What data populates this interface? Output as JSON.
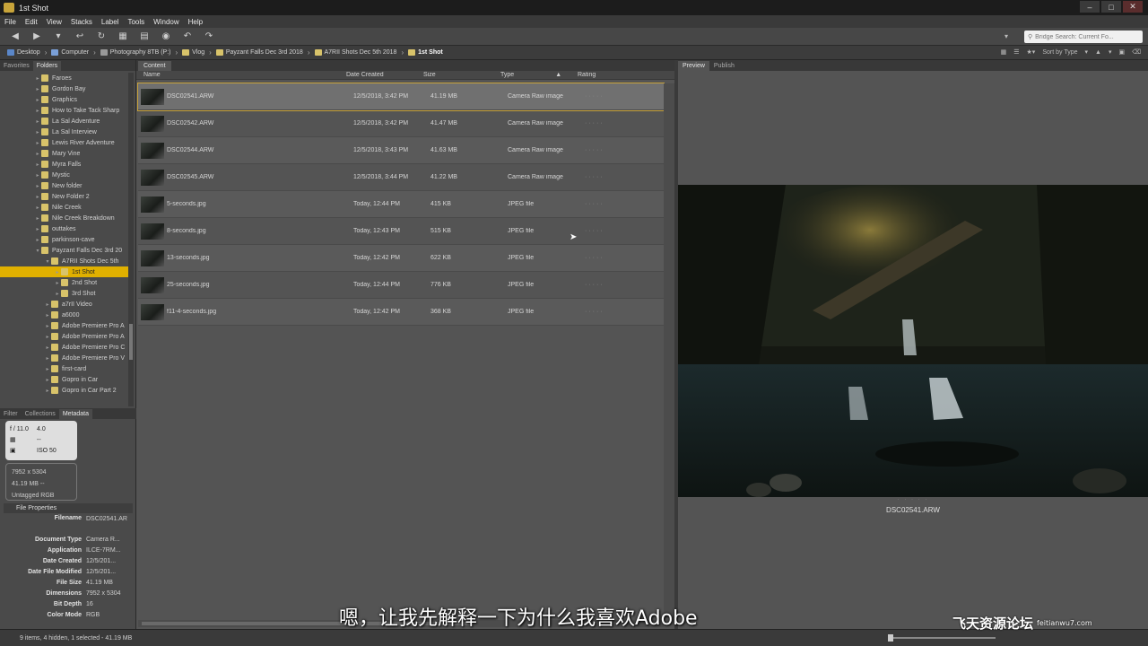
{
  "window": {
    "title": "1st Shot"
  },
  "menu": [
    "File",
    "Edit",
    "View",
    "Stacks",
    "Label",
    "Tools",
    "Window",
    "Help"
  ],
  "search": {
    "placeholder": "Bridge Search: Current Fo..."
  },
  "breadcrumb": [
    {
      "label": "Desktop"
    },
    {
      "label": "Computer"
    },
    {
      "label": "Photography 8TB (P:)"
    },
    {
      "label": "Vlog"
    },
    {
      "label": "Payzant Falls Dec 3rd 2018"
    },
    {
      "label": "A7RII Shots Dec 5th 2018"
    },
    {
      "label": "1st Shot"
    }
  ],
  "sort_label": "Sort by Type",
  "left_tabs": [
    "Favorites",
    "Folders"
  ],
  "folders": [
    {
      "label": "Faroes",
      "depth": 0
    },
    {
      "label": "Gordon Bay",
      "depth": 0
    },
    {
      "label": "Graphics",
      "depth": 0
    },
    {
      "label": "How to Take Tack Sharp",
      "depth": 0
    },
    {
      "label": "La Sal Adventure",
      "depth": 0
    },
    {
      "label": "La Sal Interview",
      "depth": 0
    },
    {
      "label": "Lewis River Adventure",
      "depth": 0
    },
    {
      "label": "Mary Vine",
      "depth": 0
    },
    {
      "label": "Myra Falls",
      "depth": 0
    },
    {
      "label": "Mystic",
      "depth": 0
    },
    {
      "label": "New folder",
      "depth": 0
    },
    {
      "label": "New Folder 2",
      "depth": 0
    },
    {
      "label": "Nile Creek",
      "depth": 0
    },
    {
      "label": "Nile Creek Breakdown",
      "depth": 0
    },
    {
      "label": "outtakes",
      "depth": 0
    },
    {
      "label": "parkinson-cave",
      "depth": 0
    },
    {
      "label": "Payzant Falls Dec 3rd 20",
      "depth": 0
    },
    {
      "label": "A7RII Shots Dec 5th",
      "depth": 1
    },
    {
      "label": "1st Shot",
      "depth": 2,
      "selected": true
    },
    {
      "label": "2nd Shot",
      "depth": 2
    },
    {
      "label": "3rd Shot",
      "depth": 2
    },
    {
      "label": "a7rII Video",
      "depth": 1
    },
    {
      "label": "a6000",
      "depth": 1
    },
    {
      "label": "Adobe Premiere Pro A",
      "depth": 1
    },
    {
      "label": "Adobe Premiere Pro A",
      "depth": 1
    },
    {
      "label": "Adobe Premiere Pro C",
      "depth": 1
    },
    {
      "label": "Adobe Premiere Pro V",
      "depth": 1
    },
    {
      "label": "first-card",
      "depth": 1
    },
    {
      "label": "Gopro in Car",
      "depth": 1
    },
    {
      "label": "Gopro in Car Part 2",
      "depth": 1
    }
  ],
  "meta_tabs": [
    "Filter",
    "Collections",
    "Metadata"
  ],
  "exif": {
    "aperture": "f / 11.0",
    "shutter": "4.0",
    "dash": "--",
    "iso": "ISO 50"
  },
  "image_info": {
    "dimensions": "7952 x 5304",
    "size": "41.19 MB",
    "size_extra": "--",
    "color": "Untagged RGB"
  },
  "file_properties": {
    "header": "File Properties",
    "rows": [
      {
        "k": "Filename",
        "v": "DSC02541.ARW"
      },
      {
        "k": "Document Type",
        "v": "Camera R..."
      },
      {
        "k": "Application",
        "v": "ILCE-7RM..."
      },
      {
        "k": "Date Created",
        "v": "12/5/201..."
      },
      {
        "k": "Date File Modified",
        "v": "12/5/201..."
      },
      {
        "k": "File Size",
        "v": "41.19 MB"
      },
      {
        "k": "Dimensions",
        "v": "7952 x 5304"
      },
      {
        "k": "Bit Depth",
        "v": "16"
      },
      {
        "k": "Color Mode",
        "v": "RGB"
      }
    ]
  },
  "content": {
    "tab": "Content",
    "columns": [
      "Name",
      "Date Created",
      "Size",
      "Type",
      "Rating"
    ],
    "files": [
      {
        "name": "DSC02541.ARW",
        "date": "12/5/2018, 3:42 PM",
        "size": "41.19 MB",
        "type": "Camera Raw image",
        "selected": true
      },
      {
        "name": "DSC02542.ARW",
        "date": "12/5/2018, 3:42 PM",
        "size": "41.47 MB",
        "type": "Camera Raw image"
      },
      {
        "name": "DSC02544.ARW",
        "date": "12/5/2018, 3:43 PM",
        "size": "41.63 MB",
        "type": "Camera Raw image"
      },
      {
        "name": "DSC02545.ARW",
        "date": "12/5/2018, 3:44 PM",
        "size": "41.22 MB",
        "type": "Camera Raw image"
      },
      {
        "name": "5-seconds.jpg",
        "date": "Today, 12:44 PM",
        "size": "415 KB",
        "type": "JPEG file"
      },
      {
        "name": "8-seconds.jpg",
        "date": "Today, 12:43 PM",
        "size": "515 KB",
        "type": "JPEG file"
      },
      {
        "name": "13-seconds.jpg",
        "date": "Today, 12:42 PM",
        "size": "622 KB",
        "type": "JPEG file"
      },
      {
        "name": "25-seconds.jpg",
        "date": "Today, 12:44 PM",
        "size": "776 KB",
        "type": "JPEG file"
      },
      {
        "name": "f11-4-seconds.jpg",
        "date": "Today, 12:42 PM",
        "size": "368 KB",
        "type": "JPEG file"
      }
    ]
  },
  "preview": {
    "tabs": [
      "Preview",
      "Publish"
    ],
    "caption": "DSC02541.ARW"
  },
  "status": "9 items, 4 hidden, 1 selected - 41.19 MB",
  "subtitle": "嗯，让我先解释一下为什么我喜欢Adobe",
  "watermark": {
    "main": "飞天资源论坛",
    "url": "feitianwu7.com"
  }
}
